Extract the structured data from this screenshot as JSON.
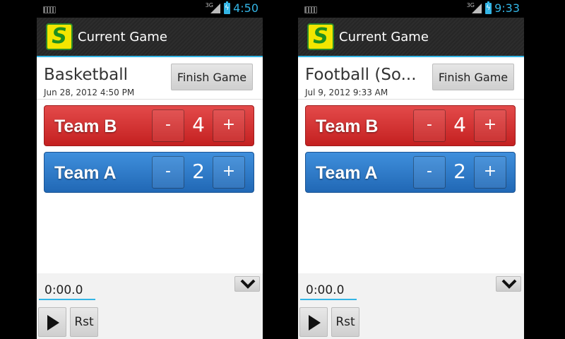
{
  "screens": [
    {
      "status_bar": {
        "network": "3G",
        "time": "4:50"
      },
      "action_bar": {
        "logo_letter": "S",
        "title": "Current Game"
      },
      "game": {
        "name": "Basketball",
        "date": "Jun 28, 2012 4:50 PM",
        "finish_label": "Finish Game"
      },
      "teams": [
        {
          "name": "Team B",
          "score": "4",
          "minus_label": "-",
          "plus_label": "+",
          "color": "#d63333"
        },
        {
          "name": "Team A",
          "score": "2",
          "minus_label": "-",
          "plus_label": "+",
          "color": "#2f7fcf"
        }
      ],
      "timer": {
        "value": "0:00.0",
        "reset_label": "Rst"
      }
    },
    {
      "status_bar": {
        "network": "3G",
        "time": "9:33"
      },
      "action_bar": {
        "logo_letter": "S",
        "title": "Current Game"
      },
      "game": {
        "name": "Football (So...",
        "date": "Jul 9, 2012 9:33 AM",
        "finish_label": "Finish Game"
      },
      "teams": [
        {
          "name": "Team B",
          "score": "4",
          "minus_label": "-",
          "plus_label": "+",
          "color": "#d63333"
        },
        {
          "name": "Team A",
          "score": "2",
          "minus_label": "-",
          "plus_label": "+",
          "color": "#2f7fcf"
        }
      ],
      "timer": {
        "value": "0:00.0",
        "reset_label": "Rst"
      }
    }
  ],
  "colors": {
    "accent": "#33b5e5",
    "team_red": "#d63333",
    "team_blue": "#2f7fcf"
  },
  "icons": [
    "keyboard-icon",
    "signal-icon",
    "battery-charging-icon",
    "chevron-down-icon",
    "play-icon"
  ]
}
